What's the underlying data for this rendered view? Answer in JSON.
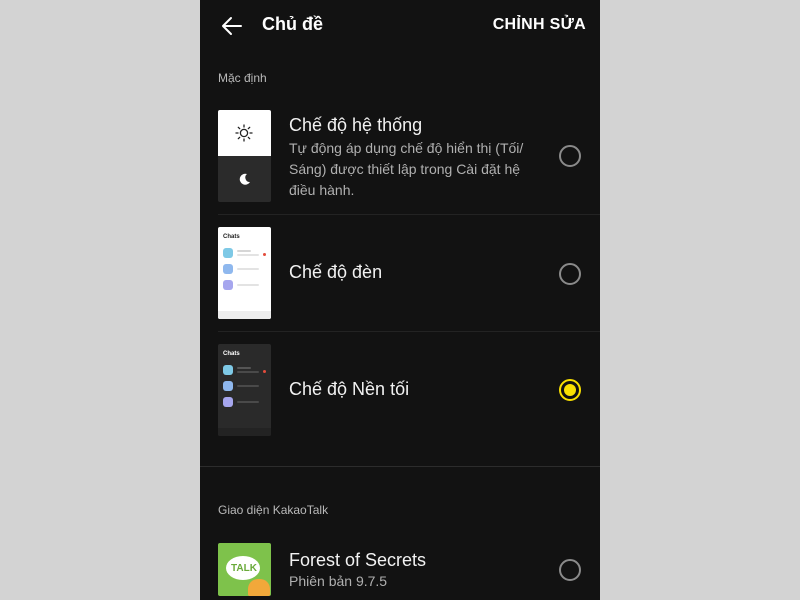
{
  "header": {
    "title": "Chủ đề",
    "edit_label": "CHỈNH SỬA"
  },
  "sections": {
    "default_label": "Mặc định",
    "kakao_label": "Giao diện KakaoTalk"
  },
  "themes": [
    {
      "title": "Chế độ hệ thống",
      "description": "Tự động áp dụng chế độ hiển thị (Tối/ Sáng) được thiết lập trong Cài đặt hệ điều hành.",
      "selected": false
    },
    {
      "title": "Chế độ đèn",
      "preview_label": "Chats",
      "selected": false
    },
    {
      "title": "Chế độ Nền tối",
      "preview_label": "Chats",
      "selected": true
    }
  ],
  "kakao_themes": [
    {
      "title": "Forest of Secrets",
      "subtitle": "Phiên bản 9.7.5",
      "badge": "TALK",
      "selected": false
    }
  ],
  "icons": {
    "back": "arrow-left-icon",
    "system": "sun-moon-icon"
  },
  "colors": {
    "background": "#121212",
    "outer_background": "#d3d3d3",
    "accent": "#f9e000",
    "radio_off": "#8a8a8a",
    "avatar_blue": "#7ec9e6",
    "avatar_light_blue": "#8fb8ee",
    "avatar_purple": "#a6a6ee",
    "kakao_green": "#7ec24b"
  }
}
